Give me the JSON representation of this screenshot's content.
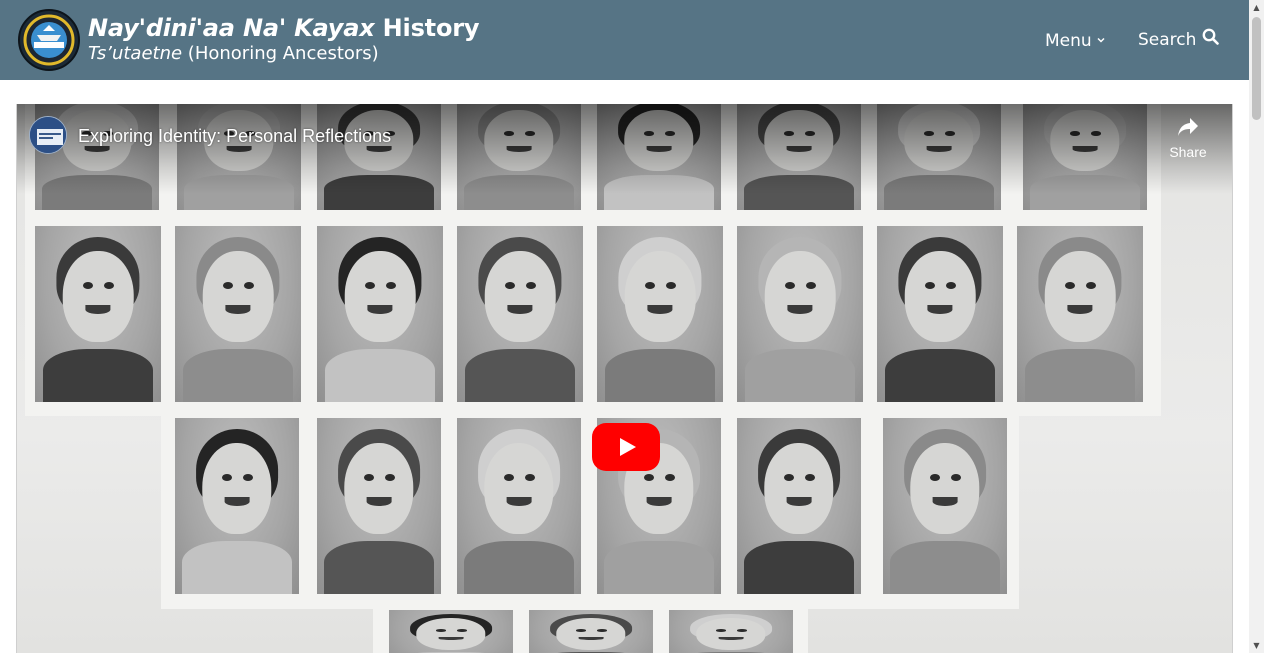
{
  "header": {
    "logo_label": "Nay'dini'aa Na' Kayax logo",
    "title_italic": "Nay'dini'aa Na' Kayax",
    "title_rest": " History",
    "subtitle_italic": "Ts’utaetne",
    "subtitle_rest": " (Honoring Ancestors)",
    "menu_label": "Menu",
    "search_label": "Search"
  },
  "icons": {
    "menu": "chevron-down-icon",
    "search": "search-icon",
    "share": "share-icon",
    "play": "play-icon"
  },
  "video": {
    "title": "Exploring Identity: Personal Reflections",
    "share_label": "Share"
  },
  "colors": {
    "header_bg": "#567485",
    "play_red": "#ff0000",
    "text_white": "#ffffff"
  }
}
